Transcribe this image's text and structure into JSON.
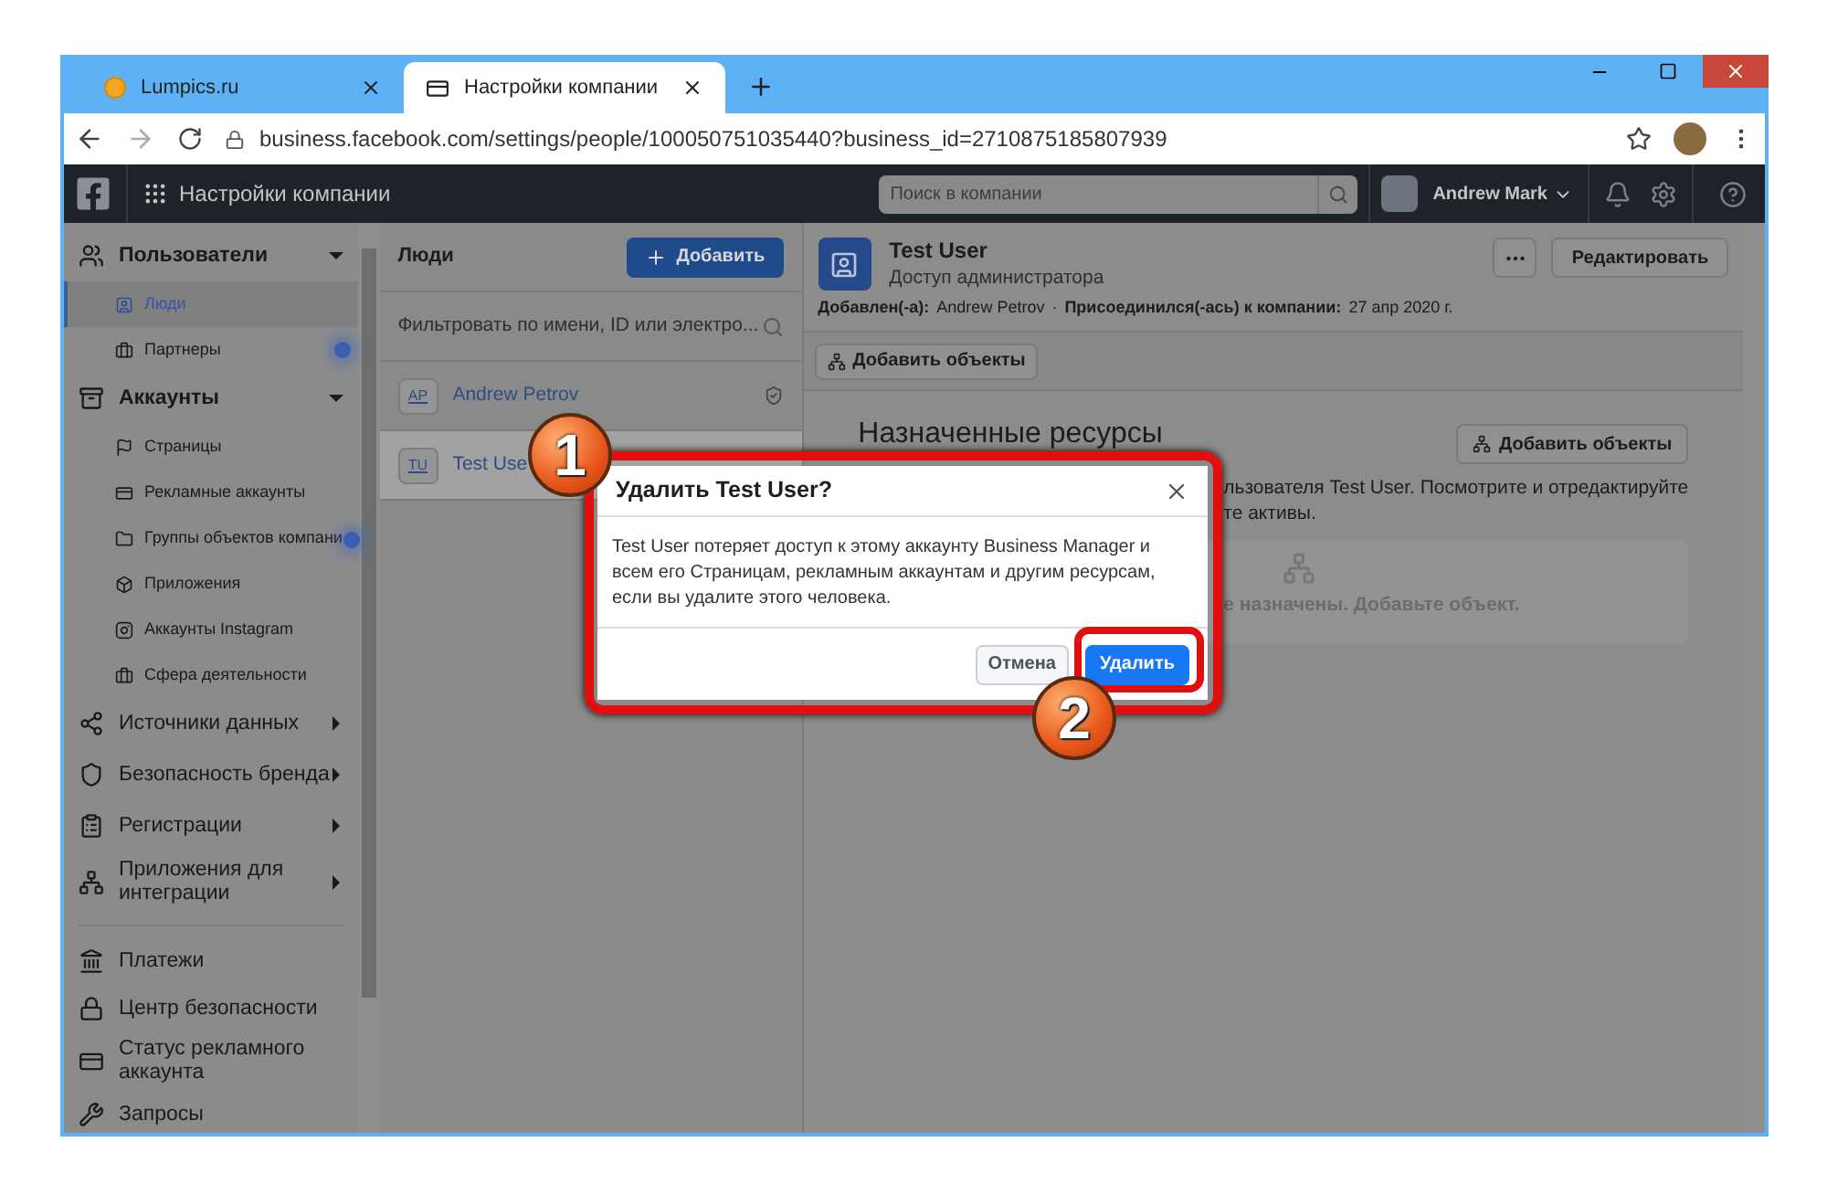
{
  "browser": {
    "tabs": [
      {
        "title": "Lumpics.ru",
        "selected": false
      },
      {
        "title": "Настройки компании",
        "selected": true
      }
    ],
    "url": "business.facebook.com/settings/people/100050751035440?business_id=2710875185807939"
  },
  "header": {
    "title": "Настройки компании",
    "search": {
      "placeholder": "Поиск в компании"
    },
    "user": "Andrew Mark"
  },
  "sidebar": {
    "sections": [
      {
        "label": "Пользователи",
        "expanded": true,
        "children": [
          {
            "label": "Люди",
            "selected": true
          },
          {
            "label": "Партнеры",
            "selected": false
          }
        ]
      },
      {
        "label": "Аккаунты",
        "expanded": true,
        "children": [
          {
            "label": "Страницы",
            "selected": false
          },
          {
            "label": "Рекламные аккаунты",
            "selected": false
          },
          {
            "label": "Группы объектов компани",
            "selected": false
          },
          {
            "label": "Приложения",
            "selected": false
          },
          {
            "label": "Аккаунты Instagram",
            "selected": false
          },
          {
            "label": "Сфера деятельности",
            "selected": false
          }
        ]
      },
      {
        "label": "Источники данных",
        "expanded": false
      },
      {
        "label": "Безопасность бренда",
        "expanded": false
      },
      {
        "label": "Регистрации",
        "expanded": false
      },
      {
        "label": "Приложения для интеграции",
        "expanded": false
      }
    ],
    "links": [
      {
        "label": "Платежи"
      },
      {
        "label": "Центр безопасности"
      },
      {
        "label": "Статус рекламного аккаунта"
      },
      {
        "label": "Запросы"
      }
    ]
  },
  "people": {
    "title": "Люди",
    "add_button": "Добавить",
    "filter": {
      "placeholder": "Фильтровать по имени, ID или электро..."
    },
    "rows": [
      {
        "initials": "AP",
        "name": "Andrew Petrov",
        "selected": false,
        "admin": true
      },
      {
        "initials": "TU",
        "name": "Test Use",
        "selected": true,
        "admin": false
      }
    ]
  },
  "detail": {
    "name": "Test User",
    "role": "Доступ администратора",
    "added_label": "Добавлен(-а):",
    "added_by": "Andrew Petrov",
    "separator": "·",
    "joined_label": "Присоединился(-ась) к компании:",
    "joined_date": "27 апр 2020 г.",
    "edit_button": "Редактировать",
    "toolbar_button": "Добавить объекты",
    "section_title": "Назначенные ресурсы",
    "section_button": "Добавить объекты",
    "description": [
      "льзователя Test User. Посмотрите и отредактируйте",
      "те активы."
    ],
    "empty_text": "е назначены. Добавьте объект."
  },
  "dialog": {
    "title": "Удалить Test User?",
    "body": "Test User потеряет доступ к этому аккаунту Business Manager и всем его Страницам, рекламным аккаунтам и другим ресурсам, если вы удалите этого человека.",
    "cancel": "Отмена",
    "confirm": "Удалить"
  },
  "annotations": [
    {
      "number": "1"
    },
    {
      "number": "2"
    }
  ]
}
